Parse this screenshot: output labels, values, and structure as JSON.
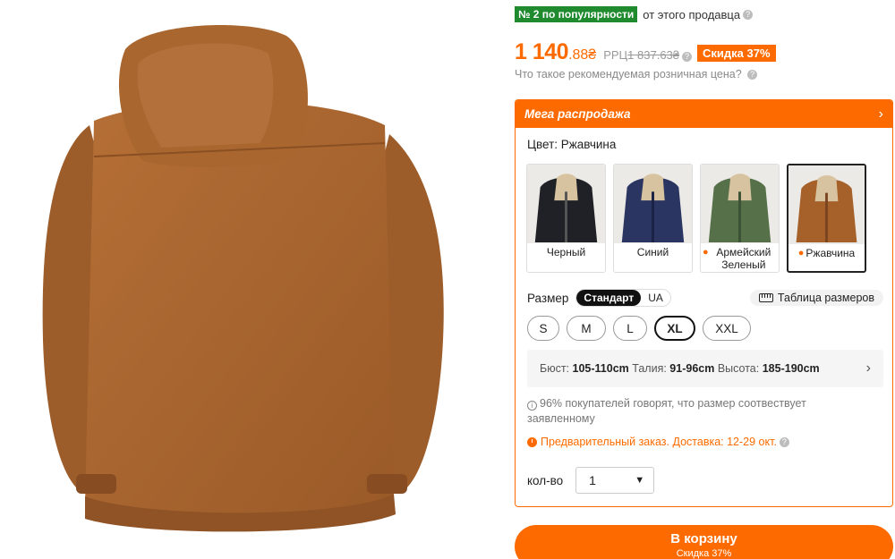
{
  "rank": {
    "badge": "№ 2 по популярности",
    "text": "от этого продавца"
  },
  "price": {
    "main": "1 140",
    "cents": ".88₴",
    "rrp_label": "РРЦ",
    "rrp_value": "1 837.63₴",
    "discount": "Скидка 37%"
  },
  "rrp_question": "Что такое рекомендуемая розничная цена?",
  "mega": {
    "title": "Мега распродажа"
  },
  "color": {
    "label": "Цвет: Ржавчина",
    "options": [
      {
        "label": "Черный",
        "hot": false,
        "color": "#1f2126"
      },
      {
        "label": "Синий",
        "hot": false,
        "color": "#2a3561"
      },
      {
        "label": "Армейский Зеленый",
        "hot": true,
        "color": "#56714a"
      },
      {
        "label": "Ржавчина",
        "hot": true,
        "color": "#a6612b"
      }
    ],
    "selected_index": 3
  },
  "size": {
    "label": "Размер",
    "standards": [
      "Стандарт",
      "UA"
    ],
    "chart_label": "Таблица размеров",
    "options": [
      "S",
      "M",
      "L",
      "XL",
      "XXL"
    ],
    "selected": "XL"
  },
  "measure": {
    "bust_label": "Бюст:",
    "bust": "105-110cm",
    "waist_label": "Талия:",
    "waist": "91-96cm",
    "height_label": "Высота:",
    "height": "185-190cm"
  },
  "fit_note": "96% покупателей говорят, что размер соотвествует заявленному",
  "preorder": "Предварительный заказ. Доставка: 12-29 окт.",
  "quantity": {
    "label": "кол-во",
    "value": "1"
  },
  "cart": {
    "label": "В корзину",
    "sub": "Скидка 37%"
  },
  "colors": {
    "accent": "#fd6b00",
    "rank_green": "#1f8a2e",
    "jacket": "#a8642e"
  }
}
